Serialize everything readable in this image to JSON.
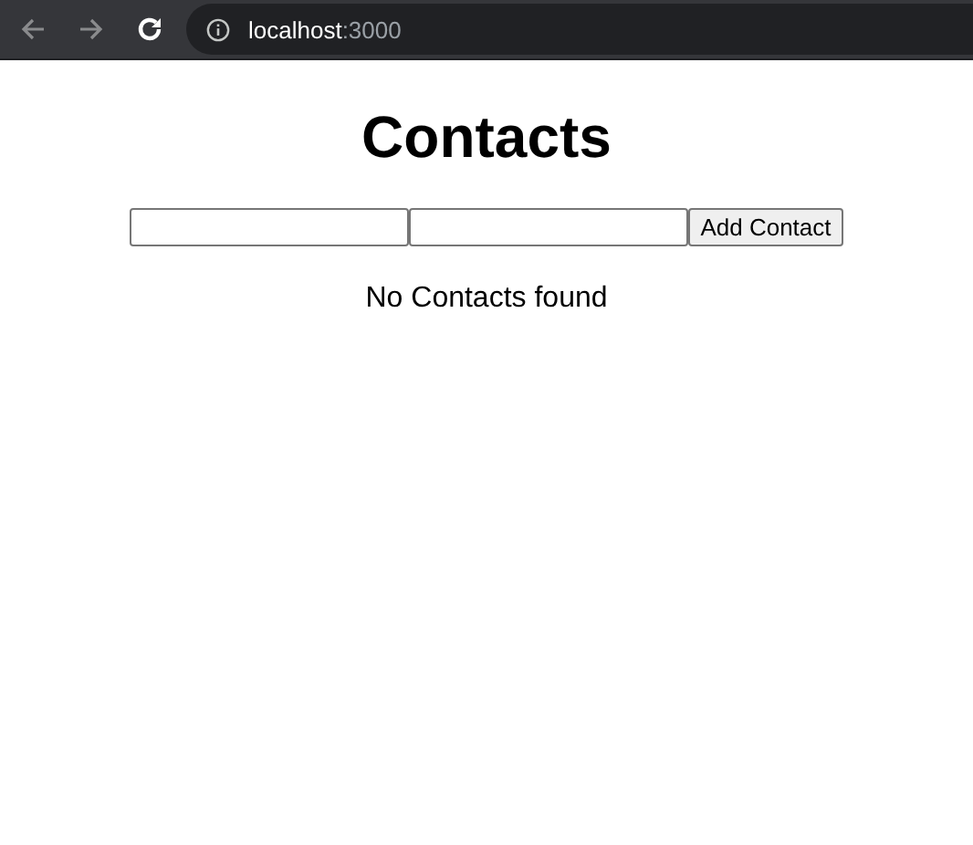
{
  "browser": {
    "back": {
      "disabled": true
    },
    "forward": {
      "disabled": true
    },
    "address": {
      "host": "localhost",
      "port": ":3000"
    }
  },
  "page": {
    "title": "Contacts",
    "form": {
      "fields": [
        {
          "kind": "text"
        },
        {
          "kind": "text"
        }
      ],
      "button": "Add Contact"
    },
    "message": "No Contacts found"
  }
}
